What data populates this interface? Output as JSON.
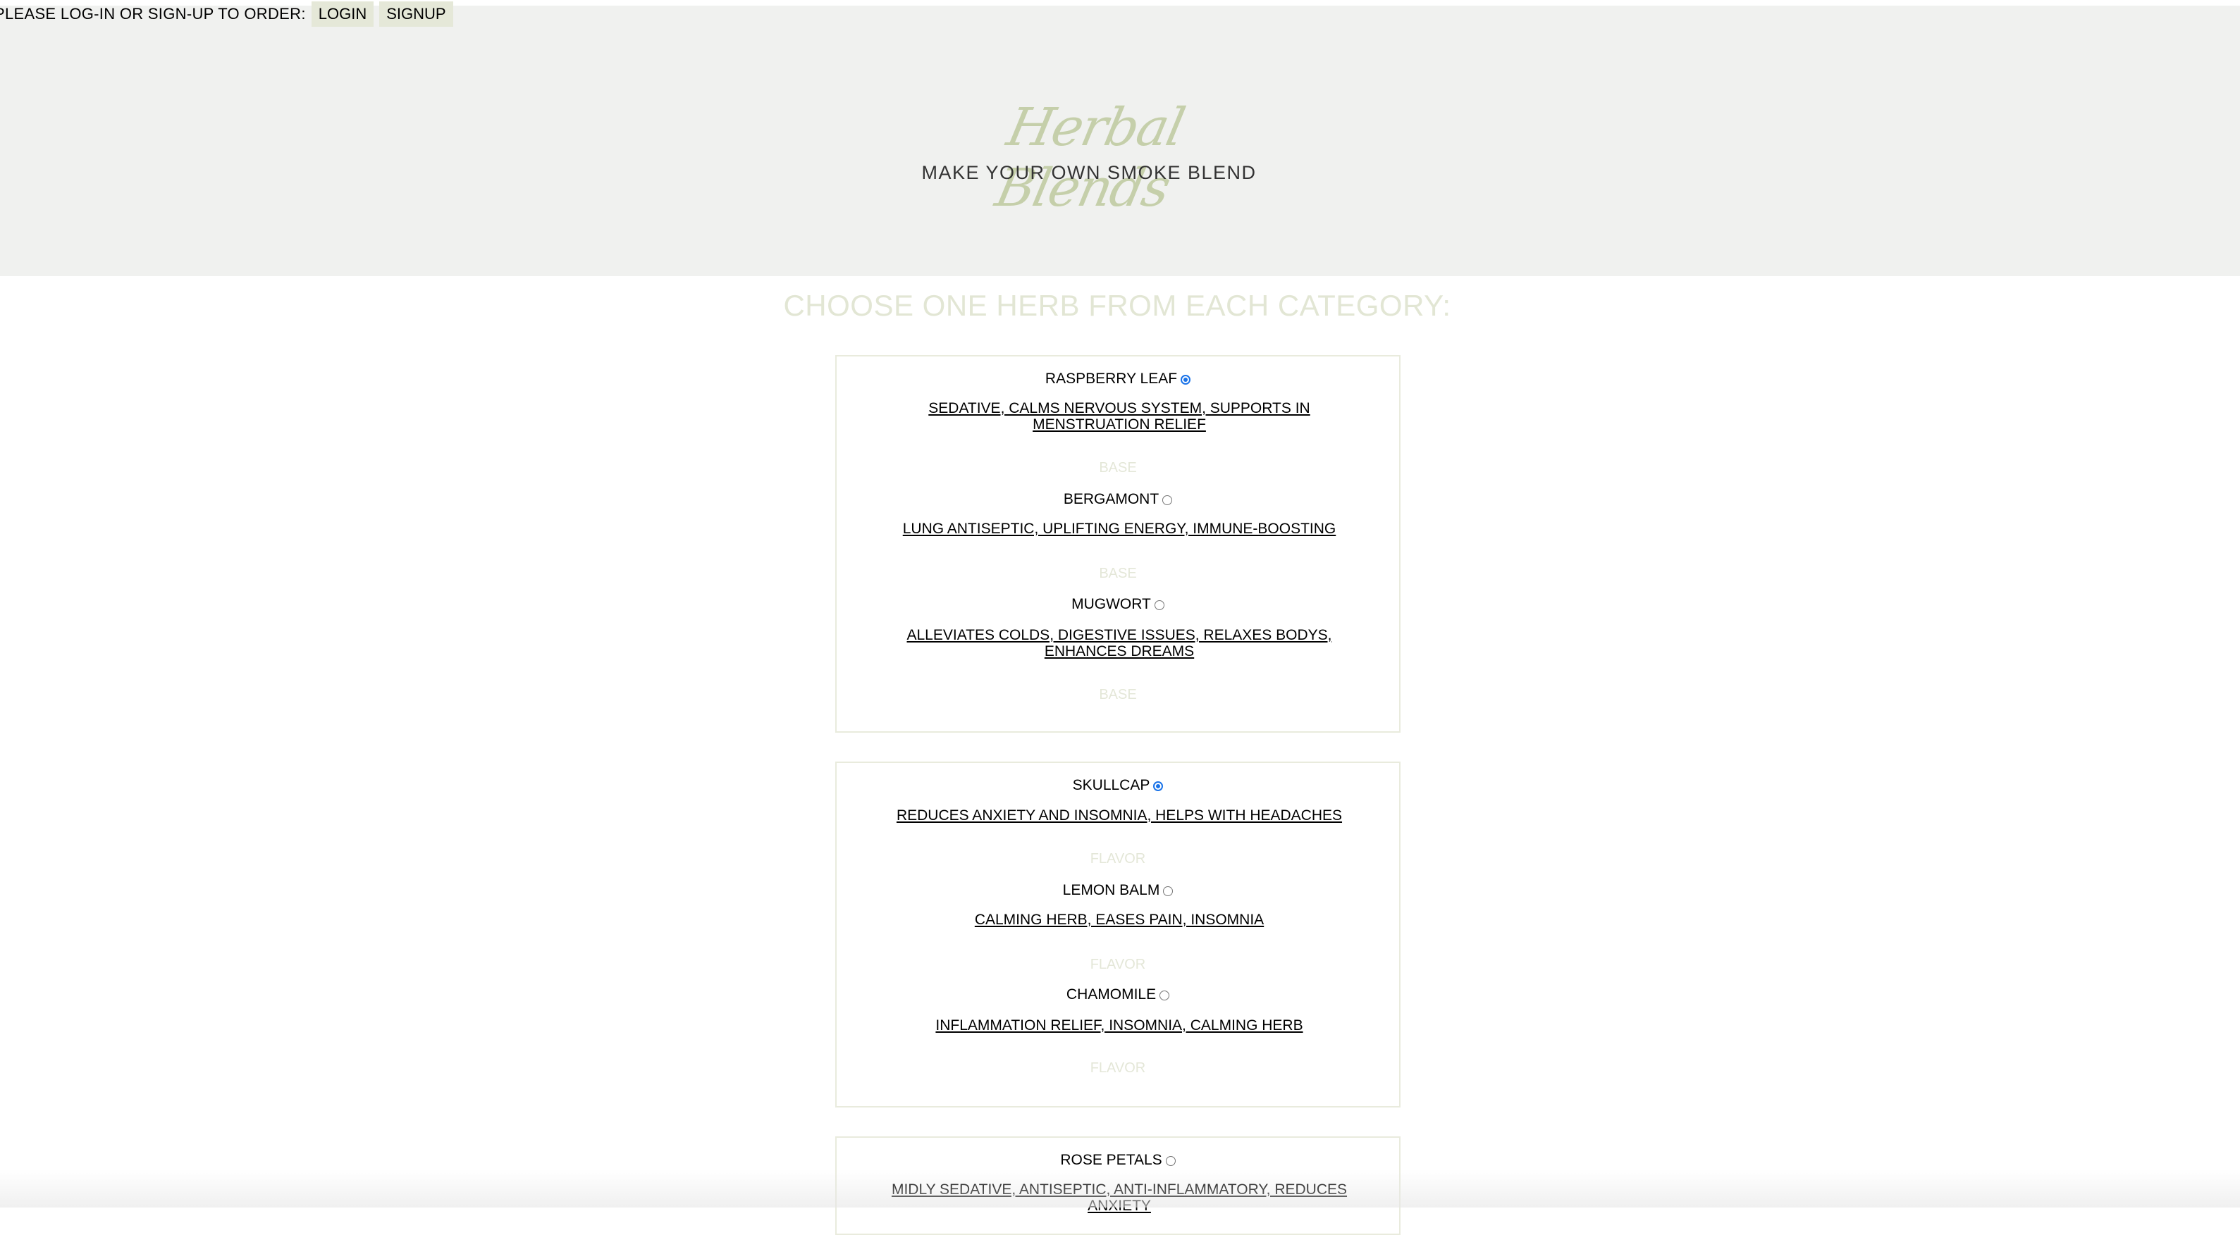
{
  "auth": {
    "prompt": "PLEASE LOG-IN OR SIGN-UP TO ORDER:",
    "login_label": "LOGIN",
    "signup_label": "SIGNUP"
  },
  "hero": {
    "logo_text": "Herbal Blends",
    "tagline": "MAKE YOUR OWN SMOKE BLEND"
  },
  "headline": "CHOOSE ONE HERB FROM EACH CATEGORY:",
  "categories": [
    {
      "herbs": [
        {
          "name": "RASPBERRY LEAF",
          "selected": true,
          "description": "SEDATIVE, CALMS NERVOUS SYSTEM, SUPPORTS IN MENSTRUATION RELIEF",
          "category": "BASE"
        },
        {
          "name": "BERGAMONT",
          "selected": false,
          "description": "LUNG ANTISEPTIC, UPLIFTING ENERGY, IMMUNE-BOOSTING",
          "category": "BASE"
        },
        {
          "name": "MUGWORT",
          "selected": false,
          "description": "ALLEVIATES COLDS, DIGESTIVE ISSUES, RELAXES BODYS, ENHANCES DREAMS",
          "category": "BASE"
        }
      ]
    },
    {
      "herbs": [
        {
          "name": "SKULLCAP",
          "selected": true,
          "description": "REDUCES ANXIETY AND INSOMNIA, HELPS WITH HEADACHES",
          "category": "FLAVOR"
        },
        {
          "name": "LEMON BALM",
          "selected": false,
          "description": "CALMING HERB, EASES PAIN, INSOMNIA",
          "category": "FLAVOR"
        },
        {
          "name": "CHAMOMILE",
          "selected": false,
          "description": "INFLAMMATION RELIEF, INSOMNIA, CALMING HERB",
          "category": "FLAVOR"
        }
      ]
    },
    {
      "herbs": [
        {
          "name": "ROSE PETALS",
          "selected": false,
          "description": "MIDLY SEDATIVE, ANTISEPTIC, ANTI-INFLAMMATORY, REDUCES ANXIETY"
        }
      ]
    }
  ],
  "colors": {
    "hero_bg": "#f0f1ef",
    "accent": "#c5cfaa",
    "button_bg": "#e5e8d8",
    "radio_selected": "#1a73e8"
  }
}
